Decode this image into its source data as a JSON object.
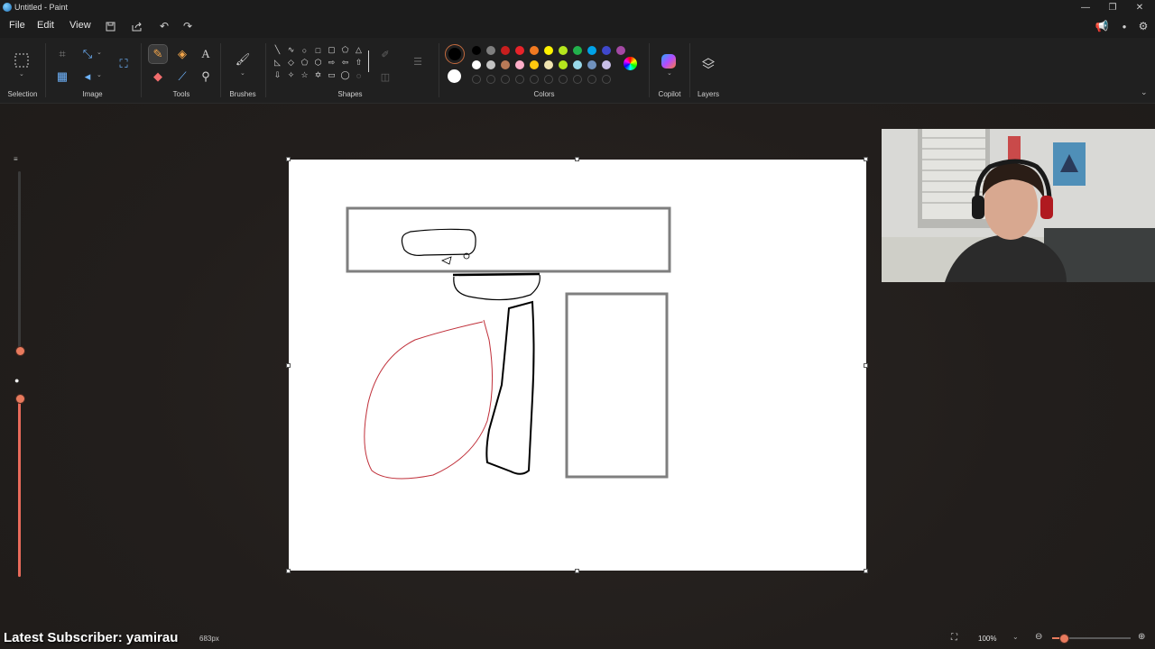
{
  "window": {
    "title": "Untitled - Paint"
  },
  "menu": {
    "file": "File",
    "edit": "Edit",
    "view": "View"
  },
  "ribbon": {
    "groups": {
      "selection": "Selection",
      "image": "Image",
      "tools": "Tools",
      "brushes": "Brushes",
      "shapes": "Shapes",
      "colors": "Colors",
      "copilot": "Copilot",
      "layers": "Layers"
    },
    "colors": {
      "primary": "#000000",
      "secondary": "#ffffff",
      "row1": [
        "#000000",
        "#7f7f7f",
        "#c81e1e",
        "#e8232a",
        "#f27a21",
        "#fff200",
        "#b5e61d",
        "#22b14c",
        "#00a2e8",
        "#3f48cc",
        "#a349a4"
      ],
      "row2": [
        "#ffffff",
        "#c3c3c3",
        "#b97a57",
        "#ffaec9",
        "#ffc90e",
        "#efe4b0",
        "#b5e61d",
        "#99d9ea",
        "#7092be",
        "#c8bfe7"
      ]
    }
  },
  "status": {
    "overlay_text": "Latest Subscriber: yamirau",
    "canvas_size": "683px",
    "zoom": "100%"
  }
}
